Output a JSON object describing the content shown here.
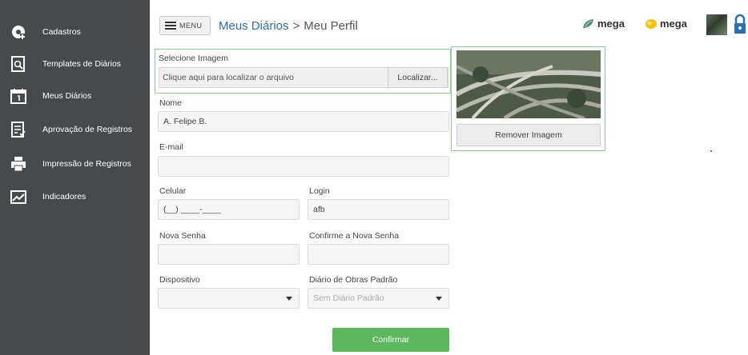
{
  "sidebar": {
    "items": [
      {
        "label": "Cadastros",
        "icon": "gear-plus-icon"
      },
      {
        "label": "Templates de Diários",
        "icon": "template-search-icon"
      },
      {
        "label": "Meus Diários",
        "icon": "calendar-icon"
      },
      {
        "label": "Aprovação de Registros",
        "icon": "approval-document-icon"
      },
      {
        "label": "Impressão de Registros",
        "icon": "printer-icon"
      },
      {
        "label": "Indicadores",
        "icon": "chart-trend-icon"
      }
    ]
  },
  "header": {
    "menu_label": "MENU",
    "breadcrumb_link": "Meus Diários",
    "breadcrumb_sep": ">",
    "breadcrumb_current": "Meu Perfil",
    "brand_1": "mega",
    "brand_2": "mega"
  },
  "form": {
    "image_label": "Selecione Imagem",
    "file_placeholder": "Clique aqui para localizar o arquivo",
    "browse_label": "Localizar...",
    "remove_image_label": "Remover Imagem",
    "name_label": "Nome",
    "name_value": "A. Felipe B.",
    "email_label": "E-mail",
    "email_value": "",
    "phone_label": "Celular",
    "phone_value": "(__) ____-____",
    "login_label": "Login",
    "login_value": "afb",
    "new_password_label": "Nova Senha",
    "confirm_password_label": "Confirme a Nova Senha",
    "device_label": "Dispositivo",
    "device_value": "",
    "default_diary_label": "Diário de Obras Padrão",
    "default_diary_value": "Sem Diário Padrão",
    "confirm_label": "Confirmar"
  },
  "colors": {
    "sidebar_bg": "#474a4d",
    "accent_link": "#2a6fb5",
    "confirm_green": "#5cb85c",
    "highlight_border": "#8fd08f"
  }
}
